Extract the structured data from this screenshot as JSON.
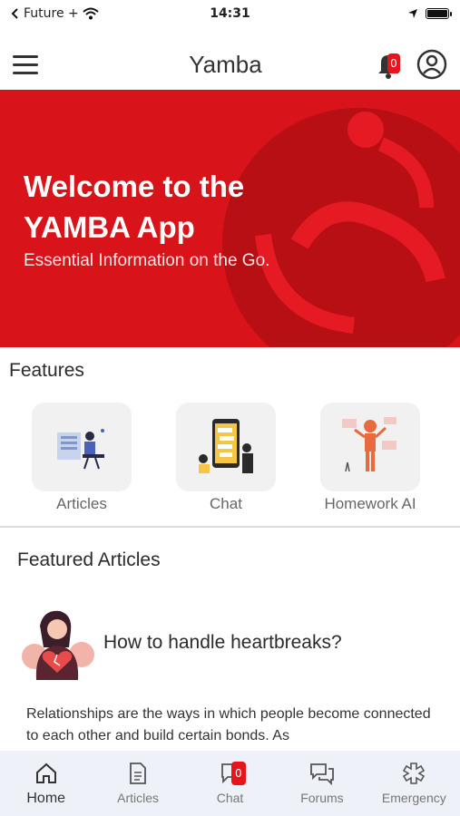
{
  "status_bar": {
    "carrier": "Future +",
    "time": "14:31"
  },
  "header": {
    "title": "Yamba",
    "notification_count": "0"
  },
  "hero": {
    "title": "Welcome to the YAMBA App",
    "subtitle": "Essential Information on the Go.",
    "background_color": "#d8131a"
  },
  "features": {
    "heading": "Features",
    "items": [
      {
        "label": "Articles",
        "icon": "articles-illustration"
      },
      {
        "label": "Chat",
        "icon": "chat-illustration"
      },
      {
        "label": "Homework AI",
        "icon": "robot-illustration"
      }
    ]
  },
  "featured_articles": {
    "heading": "Featured Articles",
    "items": [
      {
        "title": "How to handle heartbreaks?",
        "excerpt": "Relationships are the ways in which people become connected to each other and build certain bonds.  As",
        "icon": "heartbreak-illustration"
      }
    ]
  },
  "bottom_nav": {
    "items": [
      {
        "label": "Home",
        "icon": "home-icon",
        "active": true
      },
      {
        "label": "Articles",
        "icon": "document-icon"
      },
      {
        "label": "Chat",
        "icon": "chat-icon",
        "badge": "0"
      },
      {
        "label": "Forums",
        "icon": "forum-icon"
      },
      {
        "label": "Emergency",
        "icon": "emergency-icon"
      }
    ]
  },
  "colors": {
    "accent": "#e8141c",
    "nav_bg": "#eef1f7"
  }
}
